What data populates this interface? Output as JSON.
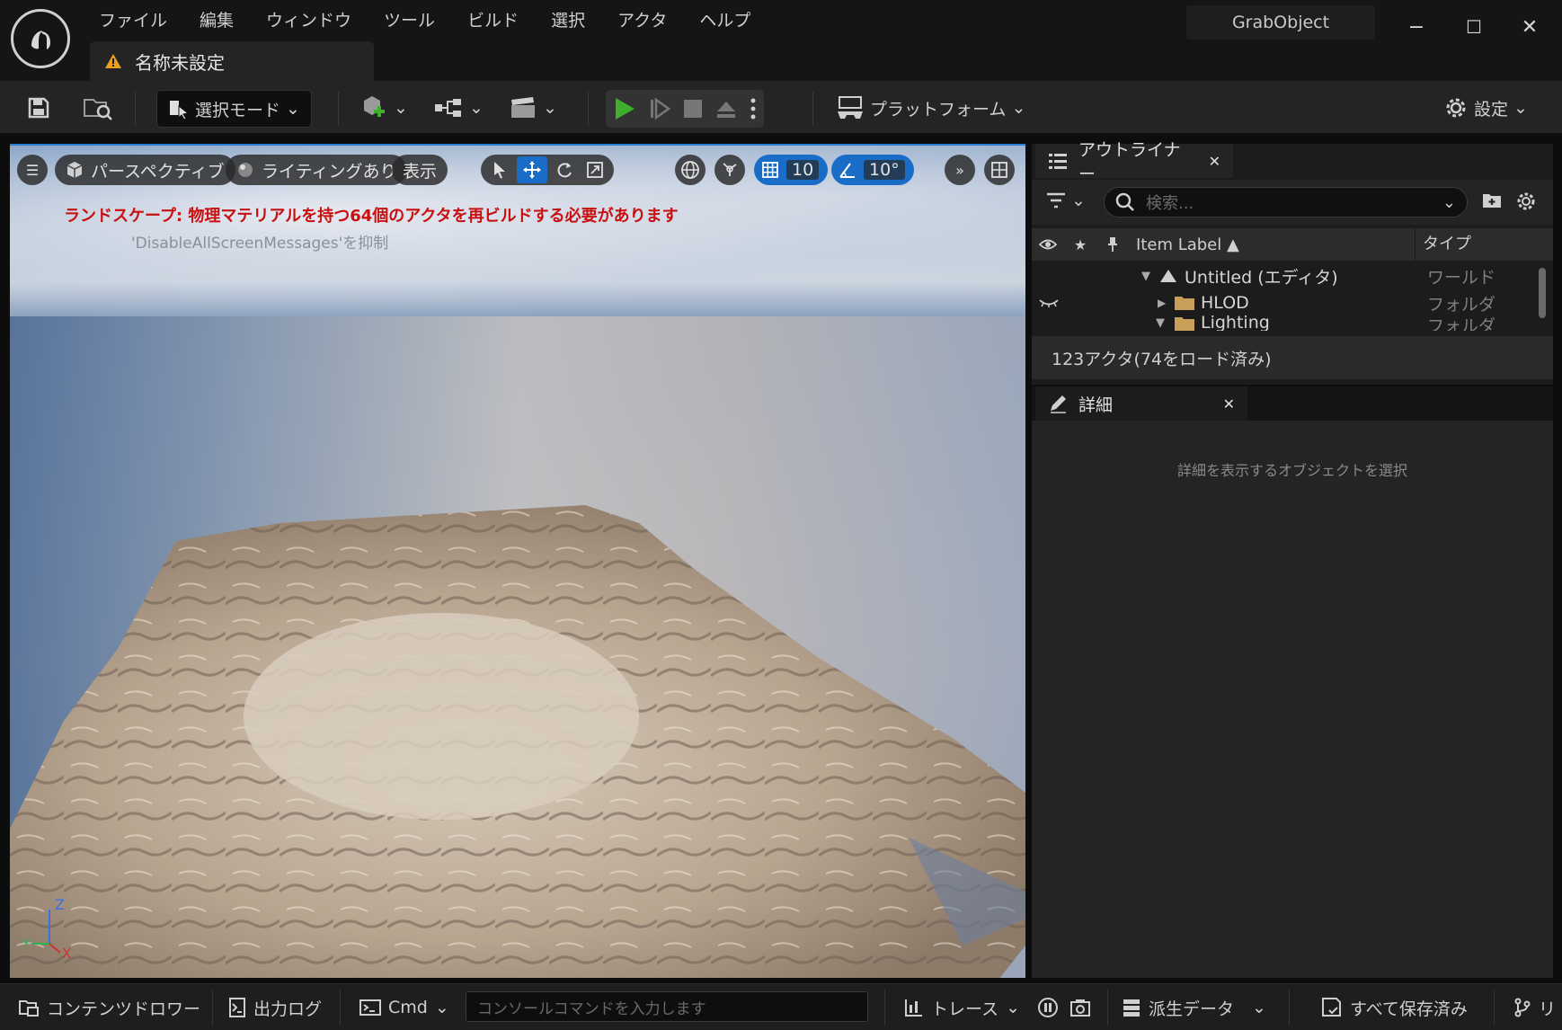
{
  "menu": [
    "ファイル",
    "編集",
    "ウィンドウ",
    "ツール",
    "ビルド",
    "選択",
    "アクタ",
    "ヘルプ"
  ],
  "document_tab": {
    "label": "名称未設定",
    "icon": "level-warning-icon"
  },
  "project_name": "GrabObject",
  "window_controls": {
    "minimize": "−",
    "maximize": "☐",
    "close": "✕"
  },
  "toolbar": {
    "select_mode": "選択モード",
    "platform": "プラットフォーム",
    "settings": "設定"
  },
  "viewport": {
    "menu_icon": "hamburger-icon",
    "perspective": "パースペクティブ",
    "lighting": "ライティングあり",
    "show": "表示",
    "grid_snap": "10",
    "rotation_snap": "10°",
    "warning": "ランドスケープ: 物理マテリアルを持つ64個のアクタを再ビルドする必要があります",
    "suppress_hint": "'DisableAllScreenMessages'を抑制",
    "axis": {
      "z": "Z",
      "y": "Y",
      "x": "X"
    }
  },
  "outliner": {
    "tab": "アウトライナー",
    "search_placeholder": "検索...",
    "col_label": "Item Label ▲",
    "col_type": "タイプ",
    "rows": [
      {
        "label": "Untitled (エディタ)",
        "type": "ワールド"
      },
      {
        "label": "HLOD",
        "type": "フォルダ"
      },
      {
        "label": "Lighting",
        "type": "フォルダ"
      }
    ],
    "footer": "123アクタ(74をロード済み)"
  },
  "details": {
    "tab": "詳細",
    "empty": "詳細を表示するオブジェクトを選択"
  },
  "statusbar": {
    "content_drawer": "コンテンツドロワー",
    "output_log": "出力ログ",
    "cmd": "Cmd",
    "console_placeholder": "コンソールコマンドを入力します",
    "trace": "トレース",
    "derived_data": "派生データ",
    "save_all": "すべて保存済み",
    "revision": "リ"
  },
  "colors": {
    "accent": "#1a6dc7",
    "play": "#3fae2c",
    "warning_text": "#c91010",
    "warning_icon": "#e8a020"
  }
}
